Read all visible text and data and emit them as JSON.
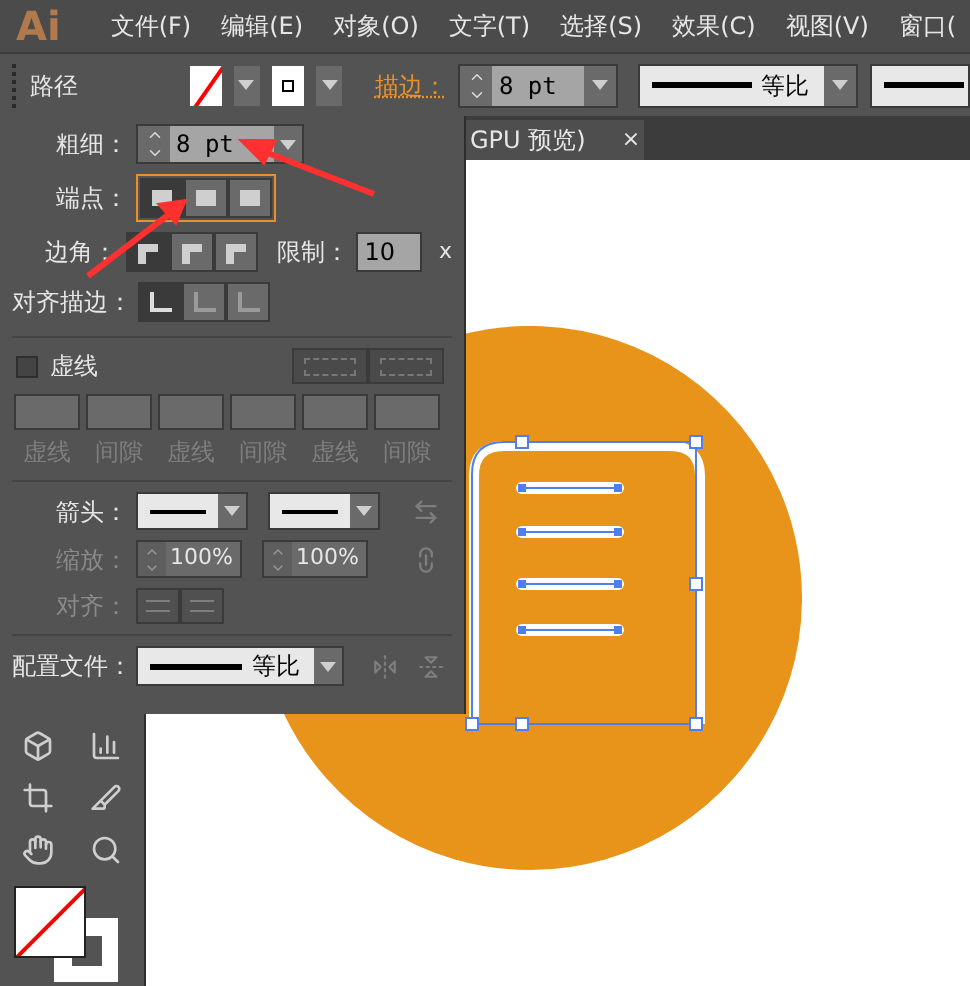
{
  "app": {
    "logo": "Ai"
  },
  "menu": [
    {
      "label": "文件(F)"
    },
    {
      "label": "编辑(E)"
    },
    {
      "label": "对象(O)"
    },
    {
      "label": "文字(T)"
    },
    {
      "label": "选择(S)"
    },
    {
      "label": "效果(C)"
    },
    {
      "label": "视图(V)"
    },
    {
      "label": "窗口("
    }
  ],
  "control_bar": {
    "title": "路径",
    "stroke_label": "描边：",
    "stroke_weight": "8 pt",
    "profile": "等比"
  },
  "document_tab": {
    "title": "GPU 预览)",
    "close": "×"
  },
  "stroke_panel": {
    "weight": {
      "label": "粗细：",
      "value": "8 pt"
    },
    "caps": {
      "label": "端点：",
      "options": [
        {
          "selected": true
        },
        {
          "selected": false
        },
        {
          "selected": false
        }
      ]
    },
    "corners": {
      "label": "边角：",
      "options": [
        {
          "selected": true
        },
        {
          "selected": false
        },
        {
          "selected": false
        }
      ],
      "limit_label": "限制：",
      "limit_value": "10",
      "limit_unit": "x"
    },
    "align": {
      "label": "对齐描边：",
      "options": [
        {
          "selected": true
        },
        {
          "selected": false
        },
        {
          "selected": false
        }
      ]
    },
    "dashed": {
      "label": "虚线",
      "checked": false,
      "disabled": true,
      "fields": [
        {
          "label": "虚线"
        },
        {
          "label": "间隙"
        },
        {
          "label": "虚线"
        },
        {
          "label": "间隙"
        },
        {
          "label": "虚线"
        },
        {
          "label": "间隙"
        }
      ]
    },
    "arrowheads": {
      "label": "箭头："
    },
    "scale": {
      "label": "缩放：",
      "disabled": true,
      "values": [
        "100%",
        "100%"
      ]
    },
    "arrow_align": {
      "label": "对齐：",
      "disabled": true
    },
    "profile": {
      "label": "配置文件：",
      "value": "等比"
    }
  }
}
